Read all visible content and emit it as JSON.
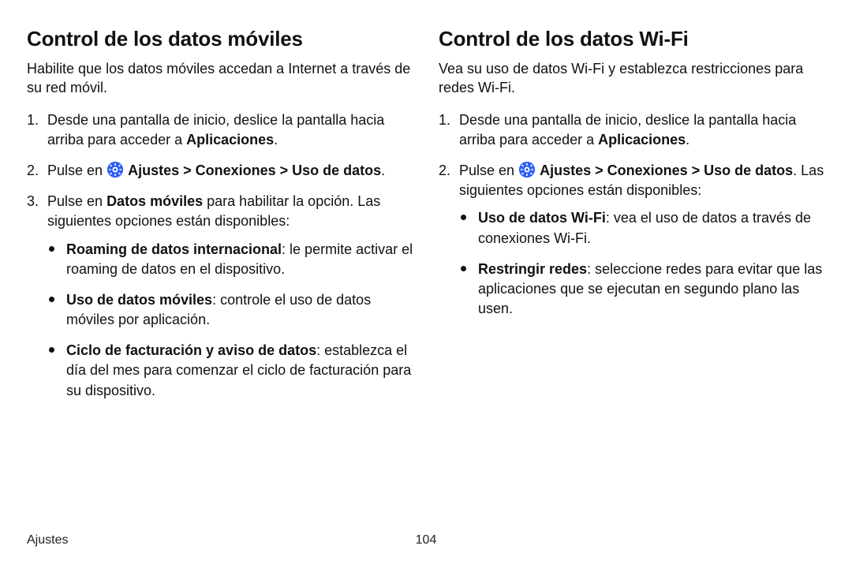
{
  "icon_color": "#2d5ef6",
  "left": {
    "heading": "Control de los datos móviles",
    "intro": "Habilite que los datos móviles accedan a Internet a través de su red móvil.",
    "step1_a": "Desde una pantalla de inicio, deslice la pantalla hacia arriba para acceder a ",
    "step1_b_bold": "Aplicaciones",
    "step1_c": ".",
    "step2_a": "Pulse en ",
    "step2_b_bold": "Ajustes > Conexiones > Uso de datos",
    "step2_c": ".",
    "step3_a": "Pulse en ",
    "step3_b_bold": "Datos móviles",
    "step3_c": " para habilitar la opción. Las siguientes opciones están disponibles:",
    "b1_bold": "Roaming de datos internacional",
    "b1_rest": ": le permite activar el roaming de datos en el dispositivo.",
    "b2_bold": "Uso de datos móviles",
    "b2_rest": ": controle el uso de datos móviles por aplicación.",
    "b3_bold": "Ciclo de facturación y aviso de datos",
    "b3_rest": ": establezca el día del mes para comenzar el ciclo de facturación para su dispositivo."
  },
  "right": {
    "heading": "Control de los datos Wi-Fi",
    "intro": "Vea su uso de datos Wi-Fi y establezca restricciones para redes Wi-Fi.",
    "step1_a": "Desde una pantalla de inicio, deslice la pantalla hacia arriba para acceder a ",
    "step1_b_bold": "Aplicaciones",
    "step1_c": ".",
    "step2_a": "Pulse en ",
    "step2_b_bold": "Ajustes > Conexiones > Uso de datos",
    "step2_c": ". Las siguientes opciones están disponibles:",
    "b1_bold": "Uso de datos Wi-Fi",
    "b1_rest": ": vea el uso de datos a través de conexiones Wi-Fi.",
    "b2_bold": "Restringir redes",
    "b2_rest": ": seleccione redes para evitar que las aplicaciones que se ejecutan en segundo plano las usen."
  },
  "footer": {
    "section": "Ajustes",
    "page": "104"
  }
}
